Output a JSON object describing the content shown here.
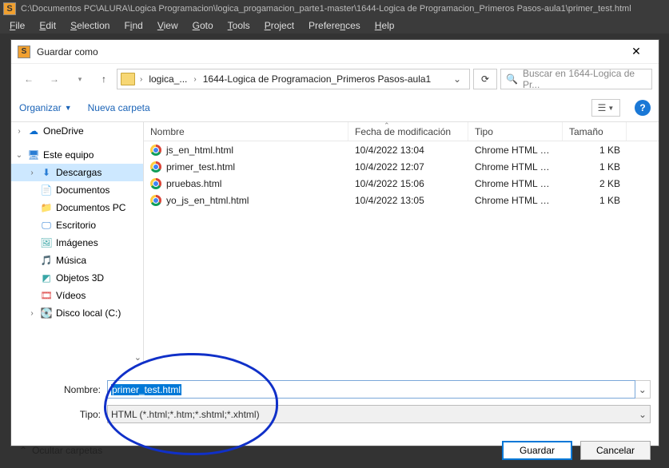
{
  "app": {
    "title_path": "C:\\Documentos PC\\ALURA\\Logica Programacion\\logica_progamacion_parte1-master\\1644-Logica de Programacion_Primeros Pasos-aula1\\primer_test.html"
  },
  "menubar": {
    "file": "File",
    "edit": "Edit",
    "selection": "Selection",
    "find": "Find",
    "view": "View",
    "goto": "Goto",
    "tools": "Tools",
    "project": "Project",
    "preferences": "Preferences",
    "help": "Help"
  },
  "dialog": {
    "title": "Guardar como",
    "breadcrumb": {
      "part1": "logica_...",
      "part2": "1644-Logica de Programacion_Primeros Pasos-aula1"
    },
    "search_placeholder": "Buscar en 1644-Logica de Pr...",
    "toolbar": {
      "organize": "Organizar",
      "newfolder": "Nueva carpeta"
    },
    "tree": {
      "onedrive": "OneDrive",
      "thispc": "Este equipo",
      "downloads": "Descargas",
      "documents": "Documentos",
      "documents_pc": "Documentos PC",
      "desktop": "Escritorio",
      "images": "Imágenes",
      "music": "Música",
      "objects3d": "Objetos 3D",
      "videos": "Vídeos",
      "localdisk": "Disco local (C:)"
    },
    "columns": {
      "name": "Nombre",
      "date": "Fecha de modificación",
      "type": "Tipo",
      "size": "Tamaño"
    },
    "files": [
      {
        "name": "js_en_html.html",
        "date": "10/4/2022 13:04",
        "type": "Chrome HTML Do...",
        "size": "1 KB"
      },
      {
        "name": "primer_test.html",
        "date": "10/4/2022 12:07",
        "type": "Chrome HTML Do...",
        "size": "1 KB"
      },
      {
        "name": "pruebas.html",
        "date": "10/4/2022 15:06",
        "type": "Chrome HTML Do...",
        "size": "2 KB"
      },
      {
        "name": "yo_js_en_html.html",
        "date": "10/4/2022 13:05",
        "type": "Chrome HTML Do...",
        "size": "1 KB"
      }
    ],
    "fields": {
      "name_label": "Nombre:",
      "name_value": "primer_test.html",
      "type_label": "Tipo:",
      "type_value": "HTML (*.html;*.htm;*.shtml;*.xhtml)"
    },
    "footer": {
      "hide_folders": "Ocultar carpetas",
      "save": "Guardar",
      "cancel": "Cancelar"
    }
  }
}
